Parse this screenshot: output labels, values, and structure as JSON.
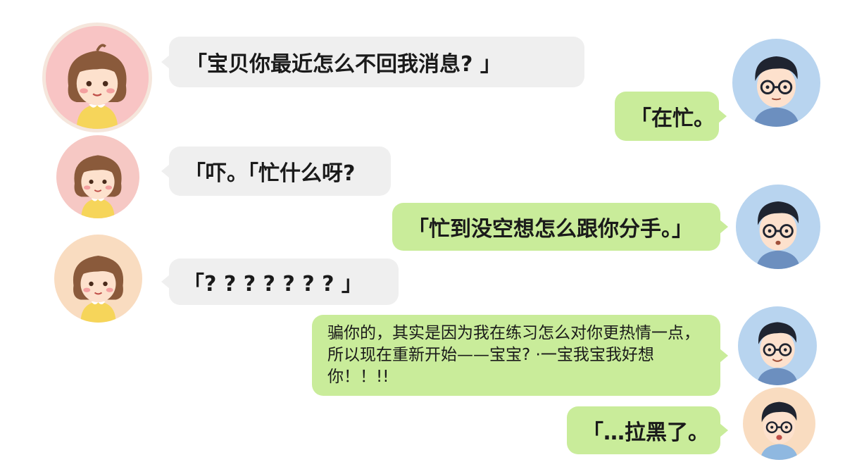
{
  "messages": [
    {
      "side": "left",
      "text": "「宝贝你最近怎么不回我消息? 」"
    },
    {
      "side": "right",
      "text": "「在忙。"
    },
    {
      "side": "left",
      "text": "「吓。「忙什么呀?"
    },
    {
      "side": "right",
      "text": "「忙到没空想怎么跟你分手。」"
    },
    {
      "side": "left",
      "text": "「? ? ? ? ? ? ? 」"
    },
    {
      "side": "right",
      "text": "骗你的，其实是因为我在练习怎么对你更热情一点，所以现在重新开始——宝宝? ·一宝我宝我好想你！！!!"
    },
    {
      "side": "right",
      "text": "「…拉黑了。"
    }
  ],
  "colors": {
    "left_bubble": "#efefef",
    "right_bubble": "#c9ec9a",
    "girl_bg": "#f8c4c4",
    "boy_bg": "#b8d4ef"
  }
}
